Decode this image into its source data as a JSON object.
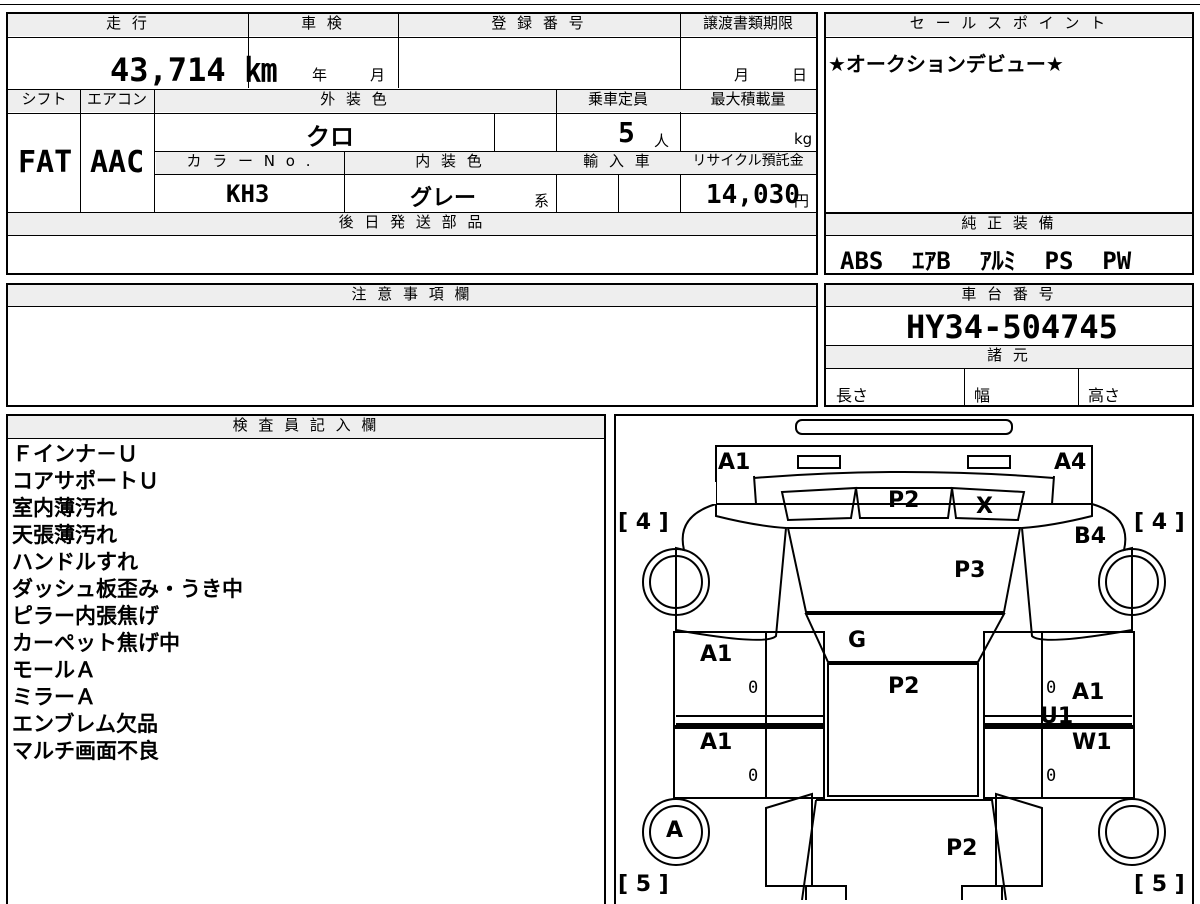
{
  "vehicle": {
    "mileage_label": "走 行",
    "mileage_value": "43,714 ㎞",
    "inspection_label": "車 検",
    "inspection_year_unit": "年",
    "inspection_month_unit": "月",
    "registration_label": "登 録 番 号",
    "transfer_label": "譲渡書類期限",
    "transfer_month_unit": "月",
    "transfer_day_unit": "日",
    "shift_label": "シフト",
    "shift_value": "FAT",
    "aircon_label": "エアコン",
    "aircon_value": "AAC",
    "exterior_color_label": "外 装 色",
    "exterior_color_value": "クロ",
    "capacity_label": "乗車定員",
    "capacity_value": "5",
    "capacity_unit": "人",
    "max_load_label": "最大積載量",
    "max_load_unit": "kg",
    "color_no_label": "カ ラ ー N o .",
    "color_no_value": "KH3",
    "interior_color_label": "内 装 色",
    "interior_color_value": "グレー",
    "interior_color_suffix": "系",
    "import_label": "輸 入 車",
    "recycle_label": "リサイクル預託金",
    "recycle_value": "14,030",
    "recycle_unit": "円",
    "later_parts_label": "後 日 発 送 部 品"
  },
  "sales_point": {
    "label": "セ ー ル ス ポ イ ン ト",
    "text": "★オークションデビュー★"
  },
  "genuine_equipment": {
    "label": "純 正 装 備",
    "text": "ABS  ｴｱB  ｱﾙﾐ  PS  PW"
  },
  "notes": {
    "label": "注 意 事 項 欄"
  },
  "chassis": {
    "label": "車 台 番 号",
    "value": "HY34-504745",
    "specs_label": "諸 元",
    "length_label": "長さ",
    "width_label": "幅",
    "height_label": "高さ"
  },
  "inspector": {
    "label": "検 査 員 記 入 欄",
    "items": [
      "Ｆインナ－Ｕ",
      "コアサポートＵ",
      "室内薄汚れ",
      "天張薄汚れ",
      "ハンドルすれ",
      "ダッシュ板歪み・うき中",
      "ピラー内張焦げ",
      "カーペット焦げ中",
      "モールＡ",
      "ミラーＡ",
      "エンブレム欠品",
      "マルチ画面不良"
    ]
  },
  "diagram": {
    "tire_fl": "[ 4 ]",
    "tire_fr": "[ 4 ]",
    "tire_rl": "[ 5 ]",
    "tire_rr": "[ 5 ]",
    "marks": {
      "front_left": "A1",
      "front_right": "A4",
      "bonnet_top": "P2",
      "bonnet_x": "X",
      "fender_right": "B4",
      "roof_front": "P3",
      "windshield": "G",
      "roof": "P2",
      "door_fl": "A1",
      "door_rl": "A1",
      "door_fr": "A1",
      "door_fr2": "U1",
      "door_rr": "W1",
      "wheel_rl": "A",
      "trunk": "P2",
      "zero": "0"
    }
  }
}
